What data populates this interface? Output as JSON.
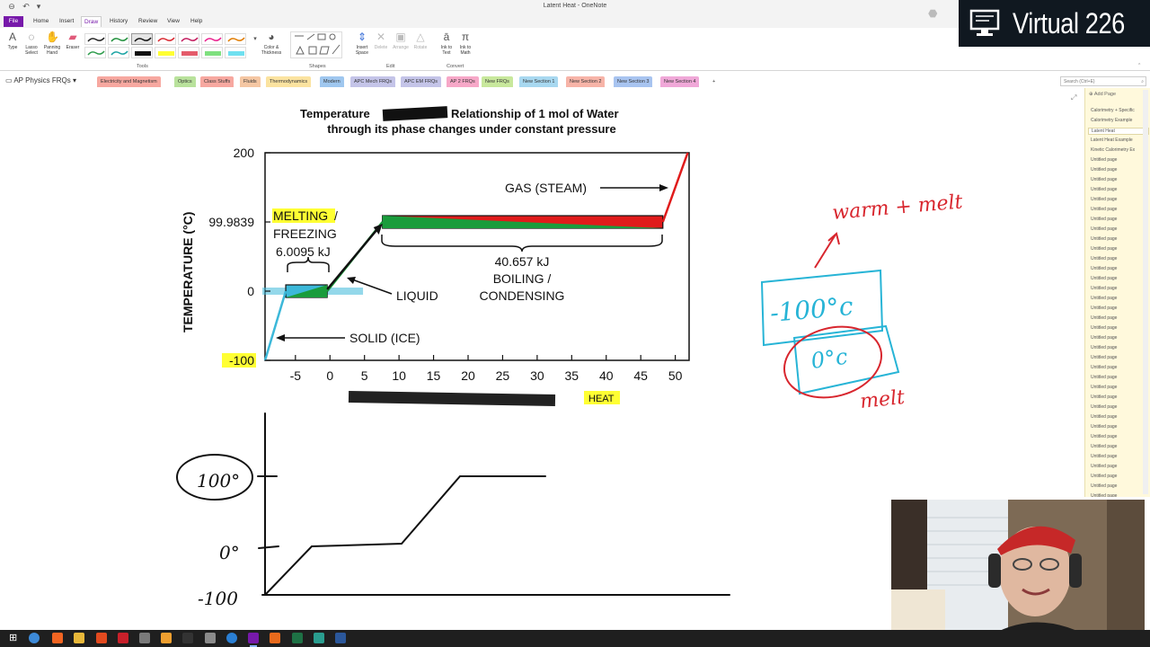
{
  "window": {
    "title": "Latent Heat - OneNote"
  },
  "ribbon_tabs": [
    {
      "label": "File"
    },
    {
      "label": "Home"
    },
    {
      "label": "Insert"
    },
    {
      "label": "Draw"
    },
    {
      "label": "History"
    },
    {
      "label": "Review"
    },
    {
      "label": "View"
    },
    {
      "label": "Help"
    }
  ],
  "ribbon": {
    "tools": {
      "type_label": "Type",
      "lasso_label": "Lasso Select",
      "panning_label": "Panning Hand",
      "eraser_label": "Eraser",
      "color_thickness_label": "Color & Thickness",
      "group_label": "Tools"
    },
    "shapes": {
      "group_label": "Shapes"
    },
    "edit": {
      "insert_space_label": "Insert Space",
      "delete_label": "Delete",
      "arrange_label": "Arrange",
      "rotate_label": "Rotate",
      "group_label": "Edit"
    },
    "convert": {
      "ink_to_text_label": "Ink to Text",
      "ink_to_math_label": "Ink to Math",
      "group_label": "Convert"
    }
  },
  "notebook": {
    "name": "AP Physics FRQs"
  },
  "sections": [
    {
      "label": "Electricity and Magnetism",
      "color": "#f7a8a0"
    },
    {
      "label": "Optics",
      "color": "#b9e29c"
    },
    {
      "label": "Class Stuffs",
      "color": "#f7a8a0"
    },
    {
      "label": "Fluids",
      "color": "#f5c7a3"
    },
    {
      "label": "Thermodynamics",
      "color": "#fbe3a0"
    },
    {
      "label": "Modern",
      "color": "#9fc7ef"
    },
    {
      "label": "APC Mech FRQs",
      "color": "#c4c4e8"
    },
    {
      "label": "APC EM FRQs",
      "color": "#c4c4e8"
    },
    {
      "label": "AP 2 FRQs",
      "color": "#f7a8c8"
    },
    {
      "label": "New FRQs",
      "color": "#c8e89c"
    },
    {
      "label": "New Section 1",
      "color": "#a8d8f0"
    },
    {
      "label": "New Section 2",
      "color": "#f7b4a8"
    },
    {
      "label": "New Section 3",
      "color": "#a8c4f0"
    },
    {
      "label": "New Section 4",
      "color": "#f0a8d8"
    },
    {
      "label": "+",
      "color": "#ffffff"
    }
  ],
  "search": {
    "placeholder": "Search (Ctrl+E)"
  },
  "pages": {
    "add_label": "Add Page",
    "items": [
      {
        "label": "Calorimetry + Specific"
      },
      {
        "label": "Calorimetry Example"
      },
      {
        "label": "Latent Heat",
        "selected": true
      },
      {
        "label": "Latent Heat Example"
      },
      {
        "label": "Kinetic Calorimetry Ex"
      },
      {
        "label": "Untitled page"
      },
      {
        "label": "Untitled page"
      },
      {
        "label": "Untitled page"
      },
      {
        "label": "Untitled page"
      },
      {
        "label": "Untitled page"
      },
      {
        "label": "Untitled page"
      },
      {
        "label": "Untitled page"
      },
      {
        "label": "Untitled page"
      },
      {
        "label": "Untitled page"
      },
      {
        "label": "Untitled page"
      },
      {
        "label": "Untitled page"
      },
      {
        "label": "Untitled page"
      },
      {
        "label": "Untitled page"
      },
      {
        "label": "Untitled page"
      },
      {
        "label": "Untitled page"
      },
      {
        "label": "Untitled page"
      },
      {
        "label": "Untitled page"
      },
      {
        "label": "Untitled page"
      },
      {
        "label": "Untitled page"
      },
      {
        "label": "Untitled page"
      },
      {
        "label": "Untitled page"
      },
      {
        "label": "Untitled page"
      },
      {
        "label": "Untitled page"
      },
      {
        "label": "Untitled page"
      },
      {
        "label": "Untitled page"
      },
      {
        "label": "Untitled page"
      },
      {
        "label": "Untitled page"
      },
      {
        "label": "Untitled page"
      },
      {
        "label": "Untitled page"
      },
      {
        "label": "Untitled page"
      },
      {
        "label": "Untitled page"
      },
      {
        "label": "Untitled page"
      },
      {
        "label": "Untitled page"
      },
      {
        "label": "Untitled page"
      },
      {
        "label": "Untitled page"
      }
    ]
  },
  "brand": {
    "title": "Virtual 226"
  },
  "chart": {
    "title_line1_a": "Temperature",
    "title_line1_b": "Relationship of 1 mol of Water",
    "title_line2": "through its phase changes under constant pressure",
    "ylabel": "TEMPERATURE (°C)",
    "xlabel_visible": "HEAT",
    "y_ticks": [
      "200",
      "99.9839",
      "0",
      "-100"
    ],
    "x_ticks": [
      "-5",
      "0",
      "5",
      "10",
      "15",
      "20",
      "25",
      "30",
      "35",
      "40",
      "45",
      "50"
    ],
    "annotations": {
      "gas": "GAS (STEAM)",
      "melting": "MELTING",
      "melting_slash": " /",
      "freezing": "FREEZING",
      "melting_energy": "6.0095 kJ",
      "boiling_energy": "40.657 kJ",
      "boiling": "BOILING /",
      "condensing": "CONDENSING",
      "liquid": "LIQUID",
      "solid": "SOLID (ICE)"
    }
  },
  "chart_data": {
    "type": "line",
    "title": "Temperature Relationship of 1 mol of Water through its phase changes under constant pressure",
    "xlabel": "HEAT",
    "ylabel": "TEMPERATURE (°C)",
    "x": [
      -9.4,
      -6.4,
      -0.4,
      7.6,
      48.2,
      51.8
    ],
    "y": [
      -100,
      0,
      0,
      99.9839,
      99.9839,
      200
    ],
    "xlim": [
      -9.4,
      52
    ],
    "ylim": [
      -100,
      200
    ],
    "phase_changes": [
      {
        "name": "MELTING / FREEZING",
        "energy_kJ": 6.0095,
        "temperature": 0
      },
      {
        "name": "BOILING / CONDENSING",
        "energy_kJ": 40.657,
        "temperature": 99.9839
      }
    ],
    "grid": false
  },
  "handwriting": {
    "sketch_labels": [
      "100°",
      "0°",
      "-100"
    ],
    "warm_melt": "warm + melt",
    "box_top": "-100°c",
    "box_bottom": "0°c",
    "melt": "melt"
  },
  "colors": {
    "accent": "#7719aa",
    "ink_red": "#d8262e",
    "ink_blue": "#27b4d6",
    "highlight_yellow": "#ffff33",
    "phase_green": "#1a9c3c",
    "phase_red": "#e01b1b",
    "phase_blue": "#3cb8d9"
  }
}
